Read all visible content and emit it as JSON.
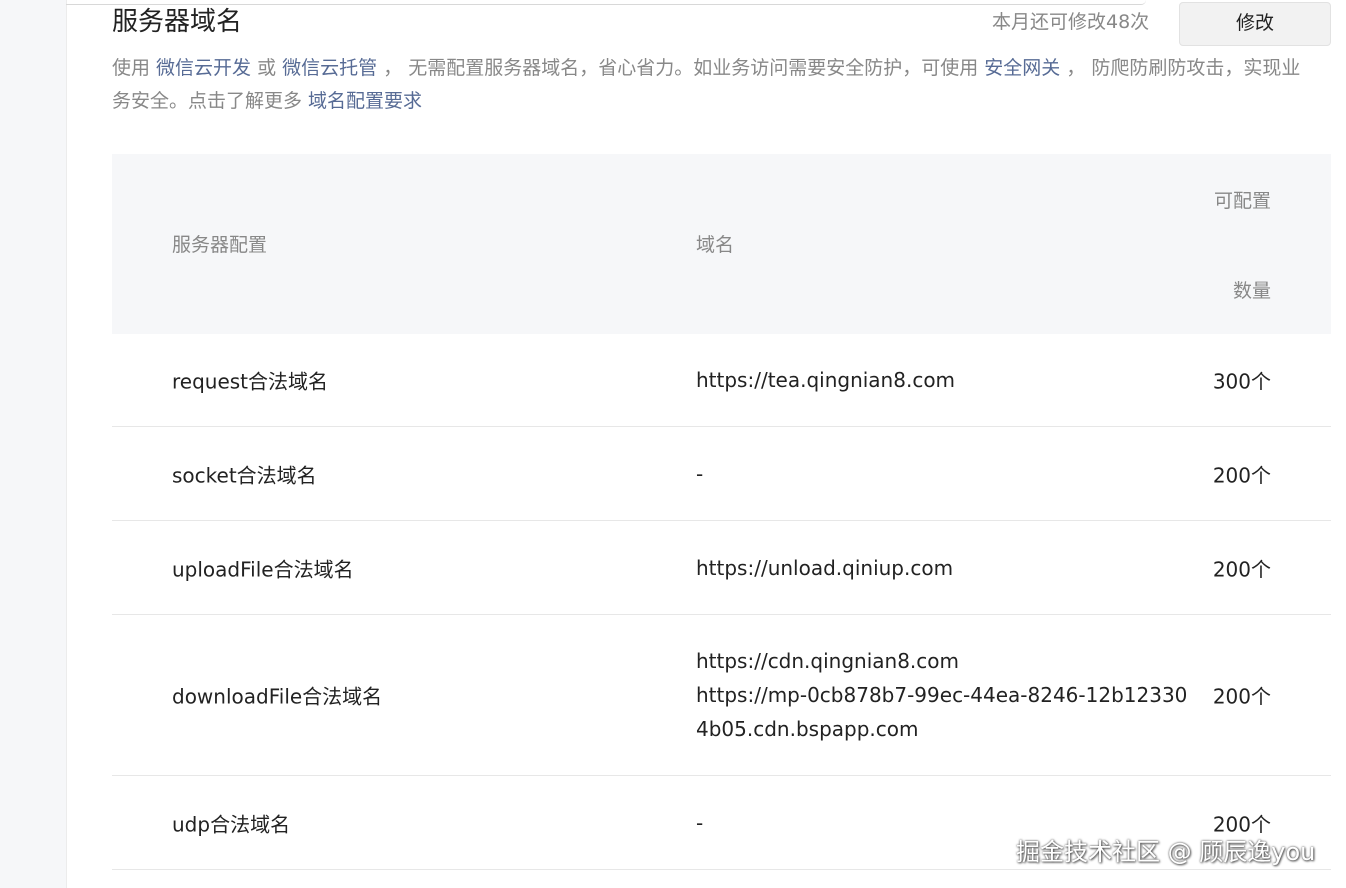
{
  "header": {
    "title": "服务器域名",
    "remaining": "本月还可修改48次",
    "modify_label": "修改"
  },
  "description": {
    "p1": "使用 ",
    "link_cloud_dev": "微信云开发",
    "p2": " 或 ",
    "link_cloud_host": "微信云托管",
    "p3": " ， 无需配置服务器域名，省心省力。如业务访问需要安全防护，可使用 ",
    "link_gateway": "安全网关",
    "p4": " ， 防爬防刷防攻击，实现业务安全。点击了解更多 ",
    "link_requirements": "域名配置要求"
  },
  "table": {
    "columns": {
      "config": "服务器配置",
      "domain": "域名",
      "count_line1": "可配置",
      "count_line2": "数量"
    },
    "rows": [
      {
        "config": "request合法域名",
        "domains": [
          "https://tea.qingnian8.com"
        ],
        "count": "300个"
      },
      {
        "config": "socket合法域名",
        "domains": [
          "-"
        ],
        "count": "200个"
      },
      {
        "config": "uploadFile合法域名",
        "domains": [
          "https://unload.qiniup.com"
        ],
        "count": "200个"
      },
      {
        "config": "downloadFile合法域名",
        "domains": [
          "https://cdn.qingnian8.com",
          "https://mp-0cb878b7-99ec-44ea-8246-12b123304b05.cdn.bspapp.com"
        ],
        "count": "200个"
      },
      {
        "config": "udp合法域名",
        "domains": [
          "-"
        ],
        "count": "200个"
      }
    ]
  },
  "watermark": "掘金技术社区 @ 顾辰逸you"
}
